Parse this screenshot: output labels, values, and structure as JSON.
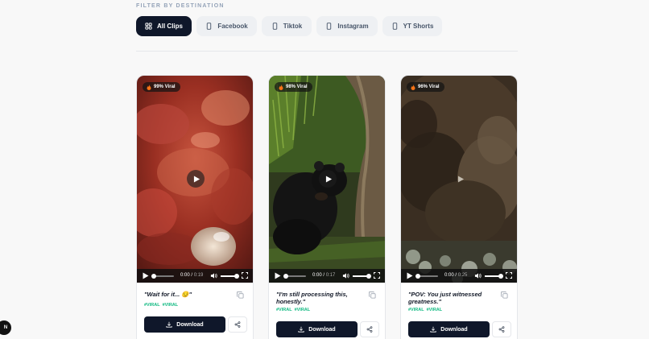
{
  "filter": {
    "heading": "FILTER BY DESTINATION",
    "options": [
      {
        "label": "All Clips",
        "icon": "grid-icon",
        "active": true
      },
      {
        "label": "Facebook",
        "icon": "phone-icon",
        "active": false
      },
      {
        "label": "Tiktok",
        "icon": "phone-icon",
        "active": false
      },
      {
        "label": "Instagram",
        "icon": "phone-icon",
        "active": false
      },
      {
        "label": "YT Shorts",
        "icon": "phone-icon",
        "active": false
      }
    ]
  },
  "clips": [
    {
      "viral_label": "99% Viral",
      "current_time": "0:00",
      "duration": "0:19",
      "progress": 0,
      "volume": 1,
      "caption": "\"Wait for it... 😏\"",
      "hashtags": [
        "#VIRAL",
        "#VIRAL"
      ],
      "download_label": "Download"
    },
    {
      "viral_label": "98% Viral",
      "current_time": "0:00",
      "duration": "0:17",
      "progress": 0,
      "volume": 1,
      "caption": "\"I'm still processing this, honestly.\"",
      "hashtags": [
        "#VIRAL",
        "#VIRAL"
      ],
      "download_label": "Download"
    },
    {
      "viral_label": "96% Viral",
      "current_time": "0:00",
      "duration": "0:25",
      "progress": 0,
      "volume": 1,
      "caption": "\"POV: You just witnessed greatness.\"",
      "hashtags": [
        "#VIRAL",
        "#VIRAL"
      ],
      "download_label": "Download"
    }
  ],
  "corner_badge": "N",
  "colors": {
    "accent_dark": "#0f172a",
    "hashtag_green": "#10b981",
    "page_background": "#f8f8f8"
  }
}
